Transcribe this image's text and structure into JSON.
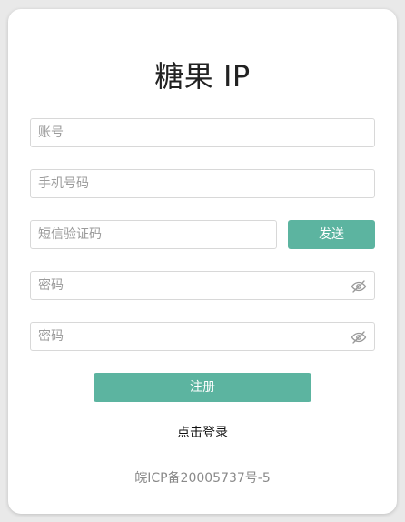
{
  "app": {
    "title": "糖果 IP"
  },
  "form": {
    "account": {
      "placeholder": "账号",
      "value": ""
    },
    "phone": {
      "placeholder": "手机号码",
      "value": ""
    },
    "sms_code": {
      "placeholder": "短信验证码",
      "value": ""
    },
    "send_label": "发送",
    "password": {
      "placeholder": "密码",
      "value": ""
    },
    "confirm_password": {
      "placeholder": "密码",
      "value": ""
    },
    "register_label": "注册",
    "login_link": "点击登录"
  },
  "footer": {
    "icp": "皖ICP备20005737号-5"
  },
  "icons": {
    "password_visibility": "eye-off-icon"
  },
  "colors": {
    "accent": "#5cb4a0",
    "page_background": "#e9e9e9",
    "card_background": "#ffffff"
  }
}
